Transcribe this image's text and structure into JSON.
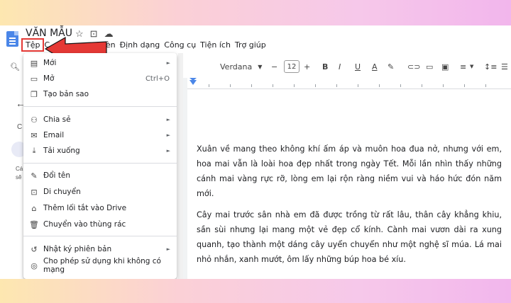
{
  "doc": {
    "title": "VĂN MẪU"
  },
  "menubar": [
    "Tệp",
    "C",
    "Chèn",
    "Định dạng",
    "Công cụ",
    "Tiện ích",
    "Trợ giúp"
  ],
  "toolbar": {
    "font": "Verdana",
    "size": "12"
  },
  "left_panel": {
    "c_label": "C",
    "ca_label": "Cá",
    "se_label": "sẽ"
  },
  "file_menu": {
    "items": [
      {
        "label": "Mới",
        "icon": "document-icon",
        "submenu": true
      },
      {
        "label": "Mở",
        "icon": "folder-open-icon",
        "shortcut": "Ctrl+O"
      },
      {
        "label": "Tạo bản sao",
        "icon": "copy-icon"
      },
      {
        "label": "Chia sẻ",
        "icon": "person-add-icon",
        "submenu": true
      },
      {
        "label": "Email",
        "icon": "email-icon",
        "submenu": true
      },
      {
        "label": "Tải xuống",
        "icon": "download-icon",
        "submenu": true
      },
      {
        "label": "Đổi tên",
        "icon": "rename-icon"
      },
      {
        "label": "Di chuyển",
        "icon": "move-folder-icon"
      },
      {
        "label": "Thêm lối tắt vào Drive",
        "icon": "drive-shortcut-icon"
      },
      {
        "label": "Chuyển vào thùng rác",
        "icon": "trash-icon"
      },
      {
        "label": "Nhật ký phiên bản",
        "icon": "history-icon",
        "submenu": true
      },
      {
        "label": "Cho phép sử dụng khi không có mạng",
        "icon": "offline-icon"
      }
    ]
  },
  "content": {
    "paragraph1": "Xuân về mang theo không khí ấm áp và muôn hoa đua nở, nhưng với em, hoa mai vẫn là loài hoa đẹp nhất trong ngày Tết. Mỗi lần nhìn thấy những cánh mai vàng rực rỡ, lòng em lại rộn ràng niềm vui và háo hức đón năm mới.",
    "paragraph2": "Cây mai trước sân nhà em đã được trồng từ rất lâu, thân cây khẳng khiu, sần sùi nhưng lại mang một vẻ đẹp cổ kính. Cành mai vươn dài ra xung quanh, tạo thành một dáng cây uyển chuyển như một nghệ sĩ múa. Lá mai nhỏ nhắn, xanh mướt, ôm lấy những búp hoa bé xíu."
  },
  "colors": {
    "highlight_box": "#e53935",
    "arrow": "#e53935",
    "docs_blue": "#4a86e8"
  }
}
